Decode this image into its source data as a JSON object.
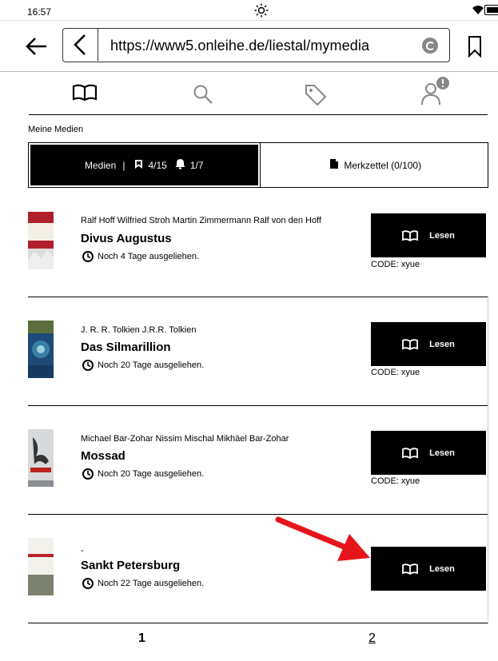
{
  "status": {
    "time": "16:57",
    "icons": [
      "sun-icon",
      "wifi-icon",
      "battery-icon"
    ]
  },
  "browser": {
    "url": "https://www5.onleihe.de/liestal/mymedia",
    "icons": [
      "back-arrow-icon",
      "chevron-left-icon",
      "reload-icon",
      "bookmark-icon"
    ]
  },
  "nav": {
    "items": [
      "book-icon",
      "search-icon",
      "tag-icon",
      "user-alert-icon"
    ]
  },
  "section_label": "Meine Medien",
  "tabs": {
    "media_label": "Medien",
    "separator": "|",
    "loans": "4/15",
    "reservations": "1/7",
    "wishlist_label": "Merkzettel (0/100)"
  },
  "items": [
    {
      "authors": "Ralf Hoff Wilfried Stroh Martin Zimmermann Ralf von den Hoff",
      "title": "Divus Augustus",
      "loan": "Noch 4 Tage ausgeliehen.",
      "button": "Lesen",
      "code": "CODE: xyue",
      "cover_color": "#b0202a"
    },
    {
      "authors": "J. R. R. Tolkien J.R.R. Tolkien",
      "title": "Das Silmarillion",
      "loan": "Noch 20 Tage ausgeliehen.",
      "button": "Lesen",
      "code": "CODE: xyue",
      "cover_color": "#1d4a78"
    },
    {
      "authors": "Michael Bar-Zohar Nissim Mischal Mikhāel Bar-Zohar",
      "title": "Mossad",
      "loan": "Noch 20 Tage ausgeliehen.",
      "button": "Lesen",
      "code": "CODE: xyue",
      "cover_color": "#c8ccd0"
    },
    {
      "authors": "-",
      "title": "Sankt Petersburg",
      "loan": "Noch 22 Tage ausgeliehen.",
      "button": "Lesen",
      "code": "",
      "cover_color": "#e8e4de"
    }
  ],
  "pagination": {
    "page1": "1",
    "page2": "2"
  },
  "annotation": {
    "arrow_color": "#e8141b"
  }
}
